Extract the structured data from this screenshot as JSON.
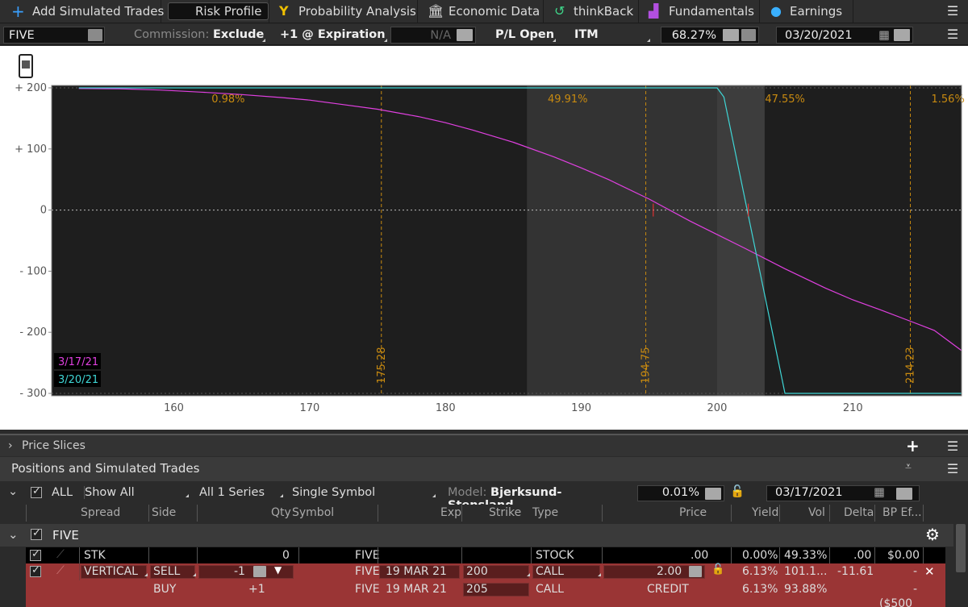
{
  "tabs": [
    {
      "label": "Add Simulated Trades",
      "icon": "plus-icon"
    },
    {
      "label": "Risk Profile",
      "icon": "risk-profile-icon",
      "active": true
    },
    {
      "label": "Probability Analysis",
      "icon": "fork-icon"
    },
    {
      "label": "Economic Data",
      "icon": "bank-icon"
    },
    {
      "label": "thinkBack",
      "icon": "history-icon"
    },
    {
      "label": "Fundamentals",
      "icon": "blocks-icon"
    },
    {
      "label": "Earnings",
      "icon": "bulb-icon"
    }
  ],
  "toolbar": {
    "symbol": "FIVE",
    "commission_label": "Commission:",
    "commission_value": "Exclude",
    "expiration": "+1 @ Expiration",
    "na": "N/A",
    "pl_mode": "P/L Open",
    "itm": "ITM",
    "percent": "68.27%",
    "date": "03/20/2021"
  },
  "chart_data": {
    "type": "line",
    "xlim": [
      151,
      218
    ],
    "ylim": [
      -300,
      200
    ],
    "x_ticks": [
      160,
      170,
      180,
      190,
      200,
      210
    ],
    "y_ticks": [
      {
        "value": 200,
        "label": "+ 200"
      },
      {
        "value": 100,
        "label": "+ 100"
      },
      {
        "value": 0,
        "label": "0"
      },
      {
        "value": -100,
        "label": "- 100"
      },
      {
        "value": -200,
        "label": "- 200"
      },
      {
        "value": -300,
        "label": "- 300"
      }
    ],
    "series": [
      {
        "name": "3/17/21",
        "color": "#e040e0",
        "points": [
          [
            153,
            199
          ],
          [
            156,
            198.5
          ],
          [
            159,
            196.5
          ],
          [
            162,
            193
          ],
          [
            165,
            189
          ],
          [
            168,
            184
          ],
          [
            170,
            180
          ],
          [
            172,
            174
          ],
          [
            175,
            165
          ],
          [
            178,
            153
          ],
          [
            180,
            143
          ],
          [
            182,
            131
          ],
          [
            185,
            111
          ],
          [
            188,
            87
          ],
          [
            190,
            69
          ],
          [
            192,
            50
          ],
          [
            195,
            18
          ],
          [
            198,
            -18
          ],
          [
            200,
            -40
          ],
          [
            202,
            -62
          ],
          [
            205,
            -96
          ],
          [
            208,
            -128
          ],
          [
            210,
            -147
          ],
          [
            212,
            -163
          ],
          [
            214,
            -180
          ],
          [
            216,
            -197
          ],
          [
            218,
            -230
          ]
        ]
      },
      {
        "name": "3/20/21",
        "color": "#3fd6d6",
        "points": [
          [
            153,
            200
          ],
          [
            200,
            200
          ],
          [
            200.5,
            185
          ],
          [
            205,
            -300
          ],
          [
            218,
            -300
          ]
        ]
      }
    ],
    "vlines": [
      175.28,
      194.75,
      214.23
    ],
    "vline_labels": [
      "175.28",
      "194.75",
      "214.23"
    ],
    "shaded": [
      186,
      203.5
    ],
    "shaded_core": [
      200,
      203.5
    ],
    "prob_labels": [
      {
        "text": "0.98%",
        "x": 164
      },
      {
        "text": "49.91%",
        "x": 189
      },
      {
        "text": "47.55%",
        "x": 205
      },
      {
        "text": "1.56%",
        "x": 217
      }
    ]
  },
  "price_slices": {
    "label": "Price Slices"
  },
  "positions": {
    "title": "Positions and Simulated Trades",
    "filter": {
      "all": "ALL",
      "show": "Show All",
      "series": "All 1 Series",
      "single": "Single Symbol",
      "model_label": "Model:",
      "model": "Bjerksund-Stensland",
      "pct": "0.01%",
      "date": "03/17/2021"
    },
    "columns": [
      "Spread",
      "Side",
      "Qty",
      "Symbol",
      "Exp",
      "Strike",
      "Type",
      "Price",
      "Yield",
      "Vol",
      "Delta",
      "BP Ef..."
    ],
    "group": "FIVE",
    "rows": [
      {
        "spread": "STK",
        "side": "",
        "qty": "0",
        "symbol": "FIVE",
        "exp": "",
        "strike": "",
        "type": "STOCK",
        "price": ".00",
        "yield": "0.00%",
        "vol": "49.33%",
        "delta": ".00",
        "bp": "$0.00"
      },
      {
        "spread": "VERTICAL",
        "side": "SELL",
        "qty": "-1",
        "symbol": "FIVE",
        "exp": "19 MAR 21",
        "strike": "200",
        "type": "CALL",
        "price": "2.00",
        "yield": "6.13%",
        "vol": "101.1...",
        "delta": "-11.61",
        "bp": "-"
      },
      {
        "spread": "",
        "side": "BUY",
        "qty": "+1",
        "symbol": "FIVE",
        "exp": "19 MAR 21",
        "strike": "205",
        "type": "CALL",
        "price": "CREDIT",
        "yield": "6.13%",
        "vol": "93.88%",
        "delta": "",
        "bp": "-"
      }
    ],
    "partial": "($500"
  },
  "colors": {
    "accent": "#ff9900",
    "row_red": "#9a3535",
    "magenta": "#e040e0",
    "cyan": "#3fd6d6"
  }
}
